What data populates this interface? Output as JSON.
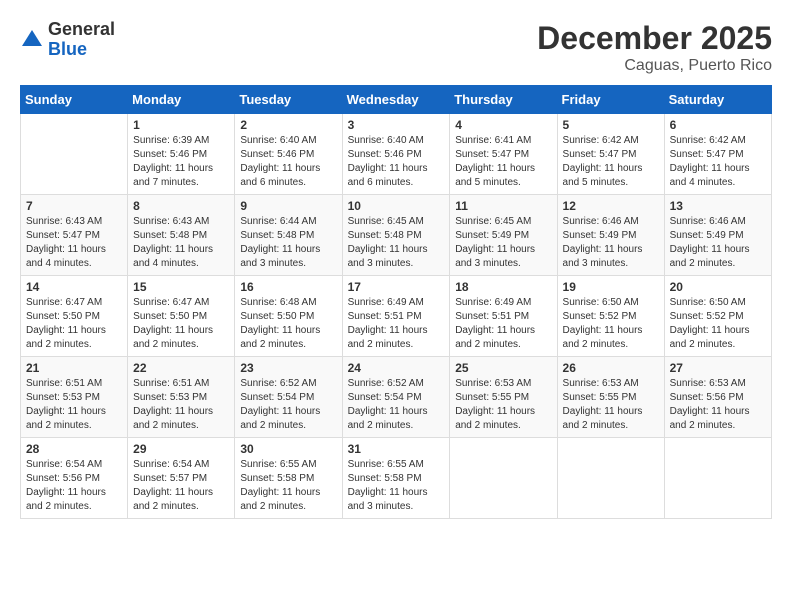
{
  "header": {
    "logo_general": "General",
    "logo_blue": "Blue",
    "month_year": "December 2025",
    "location": "Caguas, Puerto Rico"
  },
  "weekdays": [
    "Sunday",
    "Monday",
    "Tuesday",
    "Wednesday",
    "Thursday",
    "Friday",
    "Saturday"
  ],
  "weeks": [
    [
      {
        "day": "",
        "sunrise": "",
        "sunset": "",
        "daylight": ""
      },
      {
        "day": "1",
        "sunrise": "Sunrise: 6:39 AM",
        "sunset": "Sunset: 5:46 PM",
        "daylight": "Daylight: 11 hours and 7 minutes."
      },
      {
        "day": "2",
        "sunrise": "Sunrise: 6:40 AM",
        "sunset": "Sunset: 5:46 PM",
        "daylight": "Daylight: 11 hours and 6 minutes."
      },
      {
        "day": "3",
        "sunrise": "Sunrise: 6:40 AM",
        "sunset": "Sunset: 5:46 PM",
        "daylight": "Daylight: 11 hours and 6 minutes."
      },
      {
        "day": "4",
        "sunrise": "Sunrise: 6:41 AM",
        "sunset": "Sunset: 5:47 PM",
        "daylight": "Daylight: 11 hours and 5 minutes."
      },
      {
        "day": "5",
        "sunrise": "Sunrise: 6:42 AM",
        "sunset": "Sunset: 5:47 PM",
        "daylight": "Daylight: 11 hours and 5 minutes."
      },
      {
        "day": "6",
        "sunrise": "Sunrise: 6:42 AM",
        "sunset": "Sunset: 5:47 PM",
        "daylight": "Daylight: 11 hours and 4 minutes."
      }
    ],
    [
      {
        "day": "7",
        "sunrise": "Sunrise: 6:43 AM",
        "sunset": "Sunset: 5:47 PM",
        "daylight": "Daylight: 11 hours and 4 minutes."
      },
      {
        "day": "8",
        "sunrise": "Sunrise: 6:43 AM",
        "sunset": "Sunset: 5:48 PM",
        "daylight": "Daylight: 11 hours and 4 minutes."
      },
      {
        "day": "9",
        "sunrise": "Sunrise: 6:44 AM",
        "sunset": "Sunset: 5:48 PM",
        "daylight": "Daylight: 11 hours and 3 minutes."
      },
      {
        "day": "10",
        "sunrise": "Sunrise: 6:45 AM",
        "sunset": "Sunset: 5:48 PM",
        "daylight": "Daylight: 11 hours and 3 minutes."
      },
      {
        "day": "11",
        "sunrise": "Sunrise: 6:45 AM",
        "sunset": "Sunset: 5:49 PM",
        "daylight": "Daylight: 11 hours and 3 minutes."
      },
      {
        "day": "12",
        "sunrise": "Sunrise: 6:46 AM",
        "sunset": "Sunset: 5:49 PM",
        "daylight": "Daylight: 11 hours and 3 minutes."
      },
      {
        "day": "13",
        "sunrise": "Sunrise: 6:46 AM",
        "sunset": "Sunset: 5:49 PM",
        "daylight": "Daylight: 11 hours and 2 minutes."
      }
    ],
    [
      {
        "day": "14",
        "sunrise": "Sunrise: 6:47 AM",
        "sunset": "Sunset: 5:50 PM",
        "daylight": "Daylight: 11 hours and 2 minutes."
      },
      {
        "day": "15",
        "sunrise": "Sunrise: 6:47 AM",
        "sunset": "Sunset: 5:50 PM",
        "daylight": "Daylight: 11 hours and 2 minutes."
      },
      {
        "day": "16",
        "sunrise": "Sunrise: 6:48 AM",
        "sunset": "Sunset: 5:50 PM",
        "daylight": "Daylight: 11 hours and 2 minutes."
      },
      {
        "day": "17",
        "sunrise": "Sunrise: 6:49 AM",
        "sunset": "Sunset: 5:51 PM",
        "daylight": "Daylight: 11 hours and 2 minutes."
      },
      {
        "day": "18",
        "sunrise": "Sunrise: 6:49 AM",
        "sunset": "Sunset: 5:51 PM",
        "daylight": "Daylight: 11 hours and 2 minutes."
      },
      {
        "day": "19",
        "sunrise": "Sunrise: 6:50 AM",
        "sunset": "Sunset: 5:52 PM",
        "daylight": "Daylight: 11 hours and 2 minutes."
      },
      {
        "day": "20",
        "sunrise": "Sunrise: 6:50 AM",
        "sunset": "Sunset: 5:52 PM",
        "daylight": "Daylight: 11 hours and 2 minutes."
      }
    ],
    [
      {
        "day": "21",
        "sunrise": "Sunrise: 6:51 AM",
        "sunset": "Sunset: 5:53 PM",
        "daylight": "Daylight: 11 hours and 2 minutes."
      },
      {
        "day": "22",
        "sunrise": "Sunrise: 6:51 AM",
        "sunset": "Sunset: 5:53 PM",
        "daylight": "Daylight: 11 hours and 2 minutes."
      },
      {
        "day": "23",
        "sunrise": "Sunrise: 6:52 AM",
        "sunset": "Sunset: 5:54 PM",
        "daylight": "Daylight: 11 hours and 2 minutes."
      },
      {
        "day": "24",
        "sunrise": "Sunrise: 6:52 AM",
        "sunset": "Sunset: 5:54 PM",
        "daylight": "Daylight: 11 hours and 2 minutes."
      },
      {
        "day": "25",
        "sunrise": "Sunrise: 6:53 AM",
        "sunset": "Sunset: 5:55 PM",
        "daylight": "Daylight: 11 hours and 2 minutes."
      },
      {
        "day": "26",
        "sunrise": "Sunrise: 6:53 AM",
        "sunset": "Sunset: 5:55 PM",
        "daylight": "Daylight: 11 hours and 2 minutes."
      },
      {
        "day": "27",
        "sunrise": "Sunrise: 6:53 AM",
        "sunset": "Sunset: 5:56 PM",
        "daylight": "Daylight: 11 hours and 2 minutes."
      }
    ],
    [
      {
        "day": "28",
        "sunrise": "Sunrise: 6:54 AM",
        "sunset": "Sunset: 5:56 PM",
        "daylight": "Daylight: 11 hours and 2 minutes."
      },
      {
        "day": "29",
        "sunrise": "Sunrise: 6:54 AM",
        "sunset": "Sunset: 5:57 PM",
        "daylight": "Daylight: 11 hours and 2 minutes."
      },
      {
        "day": "30",
        "sunrise": "Sunrise: 6:55 AM",
        "sunset": "Sunset: 5:58 PM",
        "daylight": "Daylight: 11 hours and 2 minutes."
      },
      {
        "day": "31",
        "sunrise": "Sunrise: 6:55 AM",
        "sunset": "Sunset: 5:58 PM",
        "daylight": "Daylight: 11 hours and 3 minutes."
      },
      {
        "day": "",
        "sunrise": "",
        "sunset": "",
        "daylight": ""
      },
      {
        "day": "",
        "sunrise": "",
        "sunset": "",
        "daylight": ""
      },
      {
        "day": "",
        "sunrise": "",
        "sunset": "",
        "daylight": ""
      }
    ]
  ]
}
